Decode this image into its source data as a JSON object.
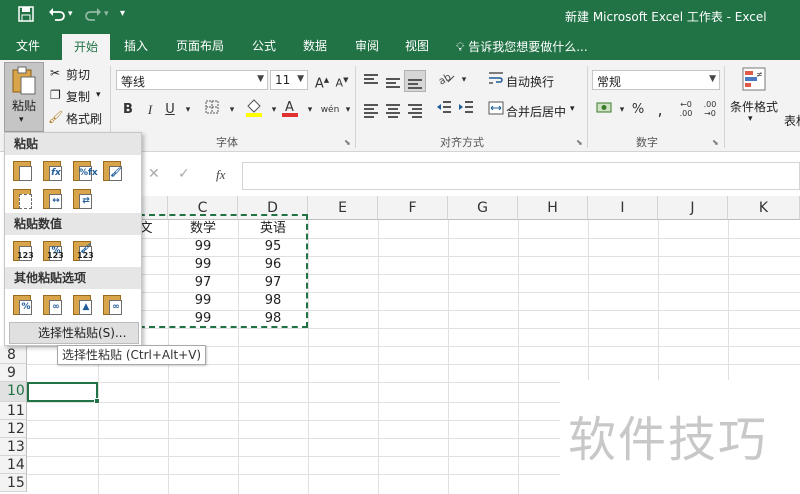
{
  "title_bar": {
    "title": "新建 Microsoft Excel 工作表 - Excel",
    "accent_color": "#217346",
    "icons": [
      "save-icon",
      "undo-icon",
      "redo-icon",
      "customize-icon"
    ]
  },
  "tabs": [
    {
      "label": "文件"
    },
    {
      "label": "开始",
      "active": true
    },
    {
      "label": "插入"
    },
    {
      "label": "页面布局"
    },
    {
      "label": "公式"
    },
    {
      "label": "数据"
    },
    {
      "label": "审阅"
    },
    {
      "label": "视图"
    }
  ],
  "tell_me": "告诉我您想要做什么...",
  "ribbon": {
    "clipboard": {
      "paste": "粘贴",
      "cut": "剪切",
      "copy": "复制",
      "format_painter": "格式刷"
    },
    "font": {
      "font_name": "等线",
      "font_size": "11",
      "group_label": "字体",
      "bold": "B",
      "italic": "I",
      "underline": "U",
      "wen": "wén"
    },
    "alignment": {
      "wrap_text": "自动换行",
      "merge_center": "合并后居中",
      "group_label": "对齐方式"
    },
    "number": {
      "format": "常规",
      "group_label": "数字",
      "percent": "%"
    },
    "styles": {
      "conditional_format": "条件格式",
      "table_partial": "表格"
    }
  },
  "formula_bar": {
    "fx": "fx",
    "value": ""
  },
  "columns": [
    "C",
    "D",
    "E",
    "F",
    "G",
    "H",
    "I",
    "J",
    "K"
  ],
  "rows": [
    "8",
    "9",
    "10",
    "11",
    "12",
    "13",
    "14",
    "15"
  ],
  "active_row": "10",
  "cells": {
    "partial_header": "文",
    "header_c": "数学",
    "header_d": "英语",
    "c_values": [
      "99",
      "99",
      "97",
      "99",
      "99"
    ],
    "d_values": [
      "95",
      "96",
      "97",
      "98",
      "98"
    ]
  },
  "paste_menu": {
    "section_paste": "粘贴",
    "section_values": "粘贴数值",
    "section_other": "其他粘贴选项",
    "paste_special": "选择性粘贴(S)...",
    "value_badge": "123"
  },
  "tooltip": "选择性粘贴 (Ctrl+Alt+V)",
  "watermark": "软件技巧"
}
